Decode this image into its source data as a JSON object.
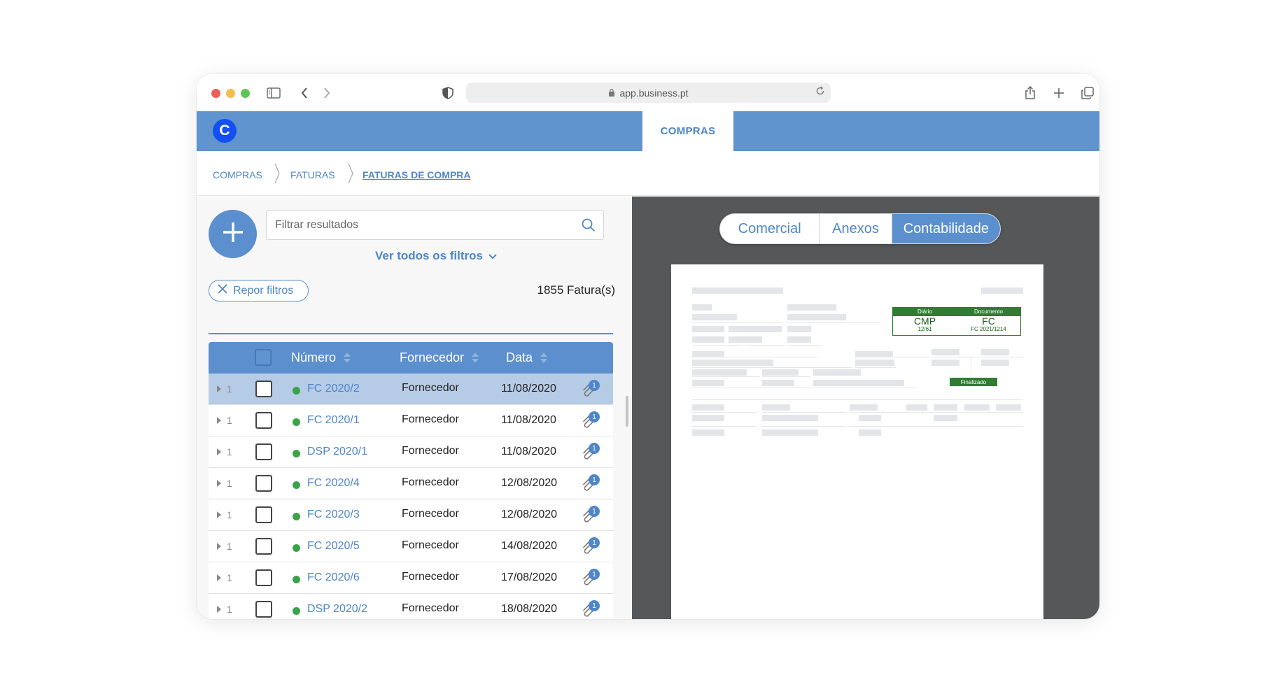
{
  "browser": {
    "url": "app.business.pt"
  },
  "app": {
    "logo_letter": "C",
    "top_tab": "COMPRAS"
  },
  "breadcrumb": {
    "items": [
      {
        "label": "COMPRAS"
      },
      {
        "label": "FATURAS"
      },
      {
        "label": "FATURAS DE COMPRA"
      }
    ]
  },
  "left": {
    "search_placeholder": "Filtrar resultados",
    "filters_link": "Ver todos os filtros",
    "reset_label": "Repor filtros",
    "count_label": "1855 Fatura(s)"
  },
  "table": {
    "columns": {
      "numero": "Número",
      "fornecedor": "Fornecedor",
      "data": "Data"
    },
    "rows": [
      {
        "count": "1",
        "numero": "FC 2020/2",
        "fornecedor": "Fornecedor",
        "data": "11/08/2020",
        "attachments": "1"
      },
      {
        "count": "1",
        "numero": "FC 2020/1",
        "fornecedor": "Fornecedor",
        "data": "11/08/2020",
        "attachments": "1"
      },
      {
        "count": "1",
        "numero": "DSP 2020/1",
        "fornecedor": "Fornecedor",
        "data": "11/08/2020",
        "attachments": "1"
      },
      {
        "count": "1",
        "numero": "FC 2020/4",
        "fornecedor": "Fornecedor",
        "data": "12/08/2020",
        "attachments": "1"
      },
      {
        "count": "1",
        "numero": "FC 2020/3",
        "fornecedor": "Fornecedor",
        "data": "12/08/2020",
        "attachments": "1"
      },
      {
        "count": "1",
        "numero": "FC 2020/5",
        "fornecedor": "Fornecedor",
        "data": "14/08/2020",
        "attachments": "1"
      },
      {
        "count": "1",
        "numero": "FC 2020/6",
        "fornecedor": "Fornecedor",
        "data": "17/08/2020",
        "attachments": "1"
      },
      {
        "count": "1",
        "numero": "DSP 2020/2",
        "fornecedor": "Fornecedor",
        "data": "18/08/2020",
        "attachments": "1"
      }
    ]
  },
  "right": {
    "tabs": [
      "Comercial",
      "Anexos",
      "Contabilidade"
    ],
    "active_tab": "Contabilidade",
    "document": {
      "diario_label": "Diário",
      "diario_value": "CMP",
      "diario_sub": "12/61",
      "documento_label": "Documento",
      "documento_value": "FC",
      "documento_sub": "FC 2021/1214",
      "status": "Finalizado"
    }
  },
  "colors": {
    "primary": "#5b8fcd",
    "appbar": "#6094cf",
    "link": "#4e86c8",
    "status_green": "#3aa34a",
    "doc_green": "#2e7d32",
    "viewer_bg": "#555758"
  },
  "icons": [
    "sidebar-icon",
    "back-icon",
    "forward-icon",
    "shield-icon",
    "lock-icon",
    "reload-icon",
    "share-icon",
    "new-tab-icon",
    "tabs-icon",
    "plus-icon",
    "search-icon",
    "chevron-down-icon",
    "close-icon",
    "paperclip-icon"
  ]
}
